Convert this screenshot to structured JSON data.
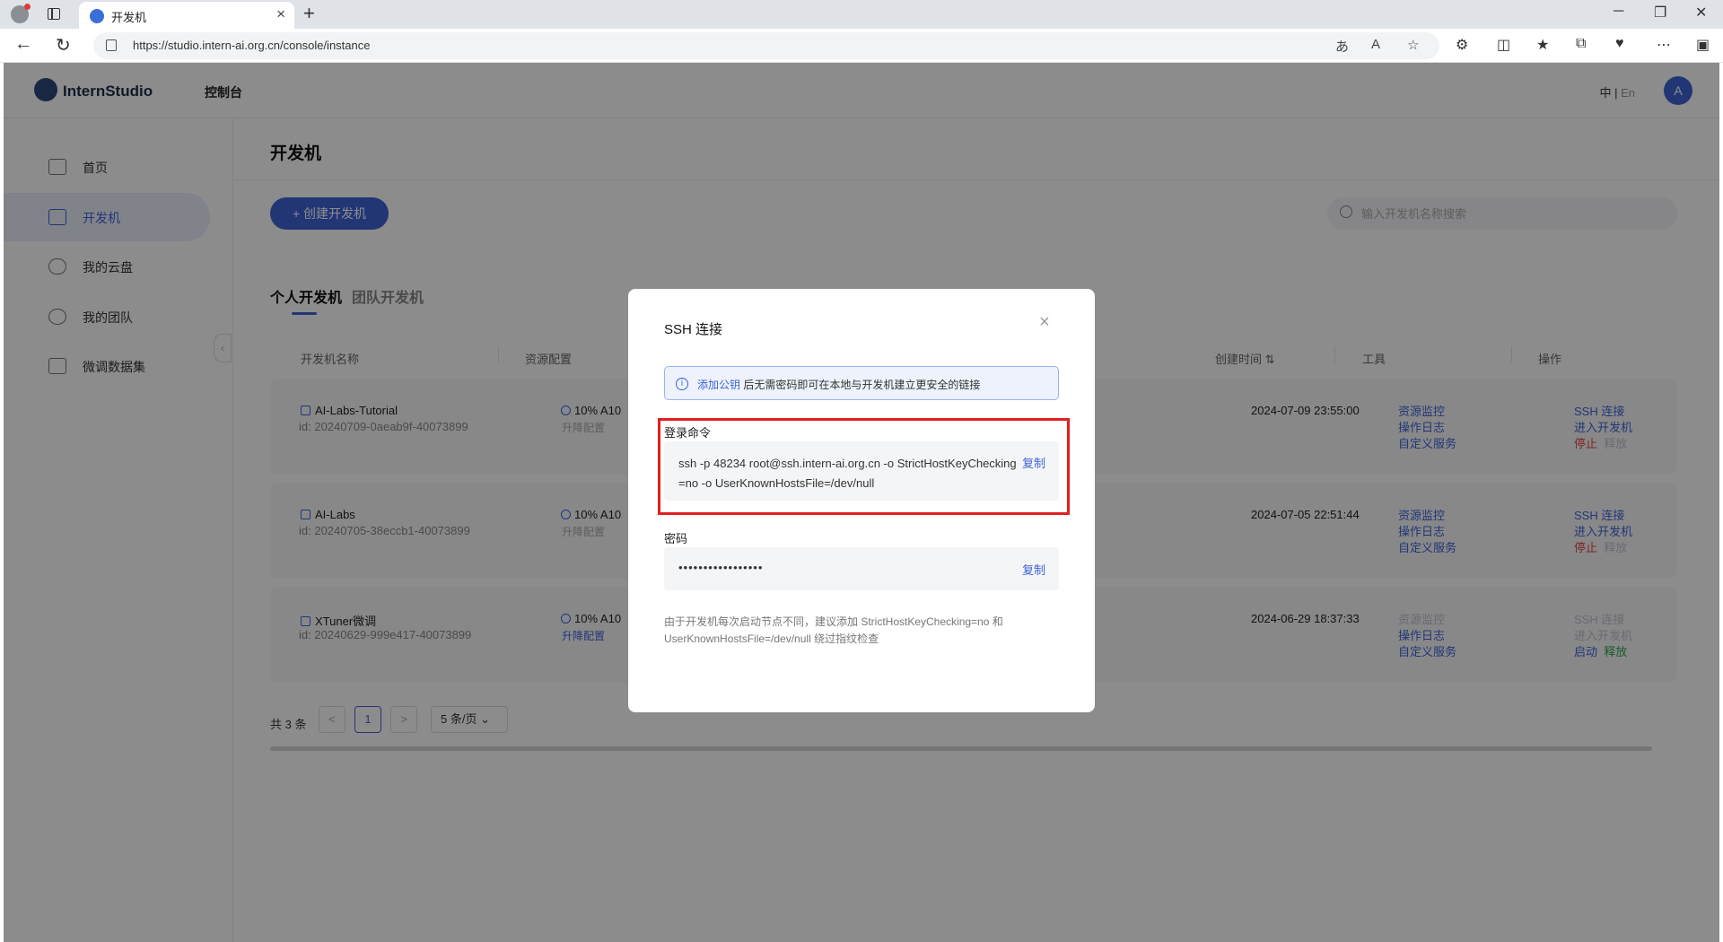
{
  "browser": {
    "tab_title": "开发机",
    "url": "https://studio.intern-ai.org.cn/console/instance"
  },
  "header": {
    "logo_text": "InternStudio",
    "console": "控制台",
    "lang_zh": "中",
    "lang_sep": "|",
    "lang_en": "En",
    "avatar": "A"
  },
  "sidebar": {
    "items": [
      {
        "label": "首页"
      },
      {
        "label": "开发机"
      },
      {
        "label": "我的云盘"
      },
      {
        "label": "我的团队"
      },
      {
        "label": "微调数据集"
      }
    ]
  },
  "main": {
    "title": "开发机",
    "create_button": "+ 创建开发机",
    "search_placeholder": "输入开发机名称搜索",
    "tabs": [
      {
        "label": "个人开发机"
      },
      {
        "label": "团队开发机"
      }
    ],
    "columns": {
      "name": "开发机名称",
      "resource": "资源配置",
      "created": "创建时间",
      "tools": "工具",
      "ops": "操作"
    },
    "rows": [
      {
        "name": "AI-Labs-Tutorial",
        "id": "id: 20240709-0aeab9f-40073899",
        "resource": "10% A10",
        "resource_sub": "升降配置",
        "created": "2024-07-09 23:55:00",
        "tools": [
          "资源监控",
          "操作日志",
          "自定义服务"
        ],
        "ssh": "SSH 连接",
        "enter": "进入开发机",
        "stop": "停止",
        "release": "释放"
      },
      {
        "name": "AI-Labs",
        "id": "id: 20240705-38eccb1-40073899",
        "resource": "10% A10",
        "resource_sub": "升降配置",
        "created": "2024-07-05 22:51:44",
        "tools": [
          "资源监控",
          "操作日志",
          "自定义服务"
        ],
        "ssh": "SSH 连接",
        "enter": "进入开发机",
        "stop": "停止",
        "release": "释放"
      },
      {
        "name": "XTuner微调",
        "id": "id: 20240629-999e417-40073899",
        "resource": "10% A10",
        "resource_sub": "升降配置",
        "created": "2024-06-29 18:37:33",
        "tools": [
          "资源监控",
          "操作日志",
          "自定义服务"
        ],
        "ssh": "SSH 连接",
        "enter": "进入开发机",
        "start": "启动",
        "release": "释放"
      }
    ],
    "pagination": {
      "total": "共 3 条",
      "prev": "<",
      "current": "1",
      "next": ">",
      "page_size": "5 条/页"
    }
  },
  "modal": {
    "title": "SSH 连接",
    "close": "×",
    "notice_link": "添加公钥",
    "notice_text": "后无需密码即可在本地与开发机建立更安全的链接",
    "login_label": "登录命令",
    "command": "ssh -p 48234 root@ssh.intern-ai.org.cn -o StrictHostKeyChecking=no -o UserKnownHostsFile=/dev/null",
    "copy_label": "复制",
    "password_label": "密码",
    "password_mask": "•••••••••••••••••",
    "hint": "由于开发机每次启动节点不同，建议添加 StrictHostKeyChecking=no 和 UserKnownHostsFile=/dev/null 绕过指纹检查"
  },
  "colors": {
    "accent": "#3e63d8",
    "danger": "#e04444",
    "success": "#2fa84f",
    "highlight_frame": "#e02020"
  }
}
